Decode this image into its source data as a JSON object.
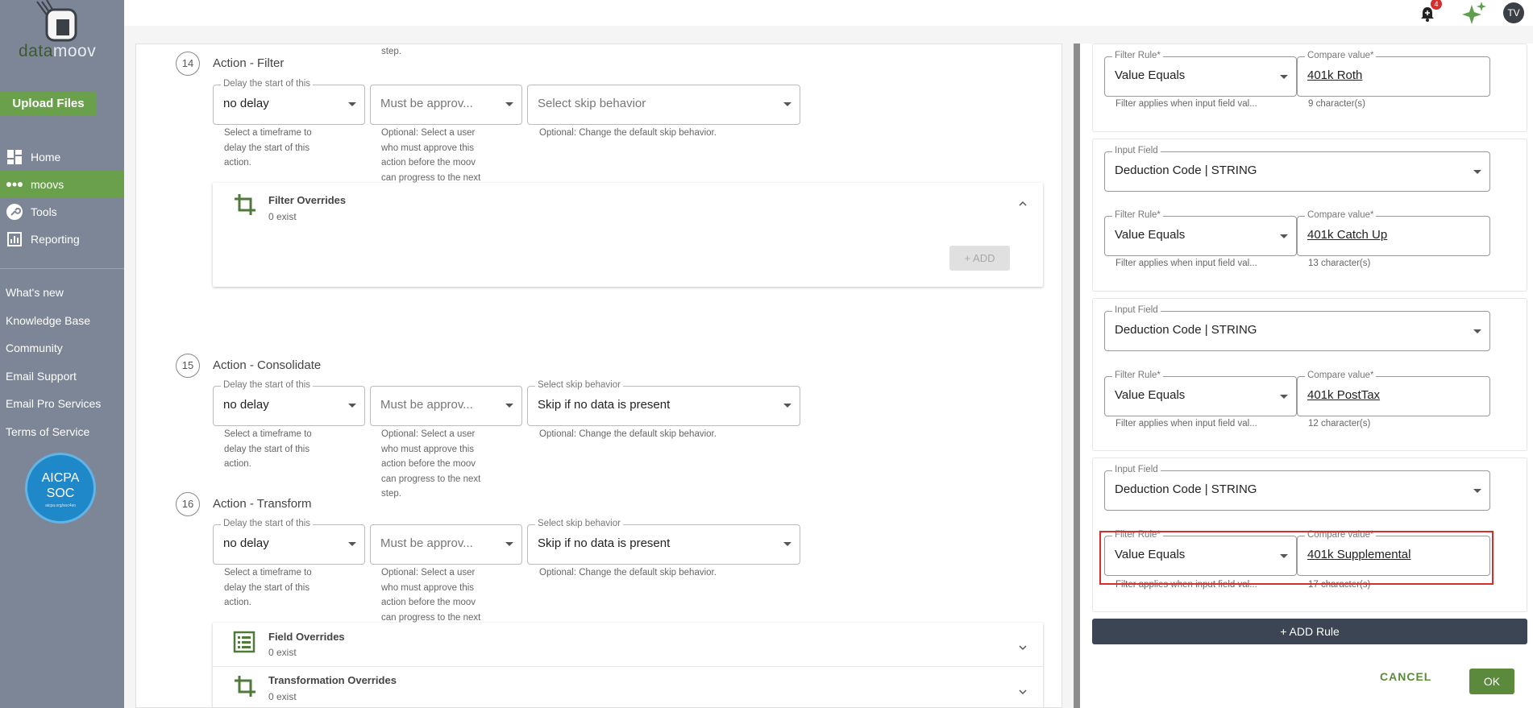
{
  "sidebar": {
    "logo": {
      "part1": "data",
      "part2": "moov"
    },
    "upload_label": "Upload Files",
    "nav": [
      {
        "label": "Home",
        "icon": "dashboard-icon"
      },
      {
        "label": "moovs",
        "icon": "dots-icon"
      },
      {
        "label": "Tools",
        "icon": "wrench-icon"
      },
      {
        "label": "Reporting",
        "icon": "report-icon"
      }
    ],
    "links": [
      "What's new",
      "Knowledge Base",
      "Community",
      "Email Support",
      "Email Pro Services",
      "Terms of Service"
    ],
    "soc_badge": {
      "line1": "AICPA",
      "line2": "SOC",
      "line3": "aicpa.org/soc4so"
    }
  },
  "topbar": {
    "notification_count": "4",
    "avatar_initials": "TV"
  },
  "actions": {
    "top_fragment": "step.",
    "a14": {
      "num": "14",
      "title": "Action - Filter",
      "delay_label": "Delay the start of this",
      "delay_value": "no delay",
      "approve_placeholder": "Must be approv...",
      "skip_placeholder": "Select skip behavior",
      "delay_help": [
        "Select a timeframe to",
        "delay the start of this",
        "action."
      ],
      "approve_help": [
        "Optional: Select a user",
        "who must approve this",
        "action before the moov",
        "can progress to the next"
      ],
      "skip_help": "Optional: Change the default skip behavior.",
      "card": {
        "title": "Filter Overrides",
        "sub": "0 exist",
        "add": "+ ADD"
      }
    },
    "a15": {
      "num": "15",
      "title": "Action - Consolidate",
      "delay_label": "Delay the start of this",
      "delay_value": "no delay",
      "approve_placeholder": "Must be approv...",
      "skip_label": "Select skip behavior",
      "skip_value": "Skip if no data is present",
      "delay_help": [
        "Select a timeframe to",
        "delay the start of this",
        "action."
      ],
      "approve_help": [
        "Optional: Select a user",
        "who must approve this",
        "action before the moov",
        "can progress to the next",
        "step."
      ],
      "skip_help": "Optional: Change the default skip behavior."
    },
    "a16": {
      "num": "16",
      "title": "Action - Transform",
      "delay_label": "Delay the start of this",
      "delay_value": "no delay",
      "approve_placeholder": "Must be approv...",
      "skip_label": "Select skip behavior",
      "skip_value": "Skip if no data is present",
      "delay_help": [
        "Select a timeframe to",
        "delay the start of this",
        "action."
      ],
      "approve_help": [
        "Optional: Select a user",
        "who must approve this",
        "action before the moov",
        "can progress to the next"
      ],
      "skip_help": "Optional: Change the default skip behavior.",
      "field_overrides": {
        "title": "Field Overrides",
        "sub": "0 exist"
      },
      "transformation_overrides": {
        "title": "Transformation Overrides",
        "sub": "0 exist"
      }
    }
  },
  "panel": {
    "input_label": "Input Field",
    "input_value": "Deduction Code | STRING",
    "filter_label": "Filter Rule*",
    "filter_value": "Value Equals",
    "compare_label": "Compare value*",
    "filter_help": "Filter applies when input field val...",
    "rules": [
      {
        "compare": "401k Roth",
        "count": "9 character(s)"
      },
      {
        "compare": "401k Catch Up",
        "count": "13 character(s)"
      },
      {
        "compare": "401k PostTax",
        "count": "12 character(s)"
      },
      {
        "compare": "401k Supplemental",
        "count": "17 character(s)"
      }
    ],
    "add_rule": "+ ADD Rule",
    "cancel": "CANCEL",
    "ok": "OK"
  },
  "colors": {
    "accent_green": "#6aa04c",
    "sidebar_bg": "#7d8696",
    "dark_button": "#3c4554",
    "highlight_red": "#d32f2f"
  }
}
